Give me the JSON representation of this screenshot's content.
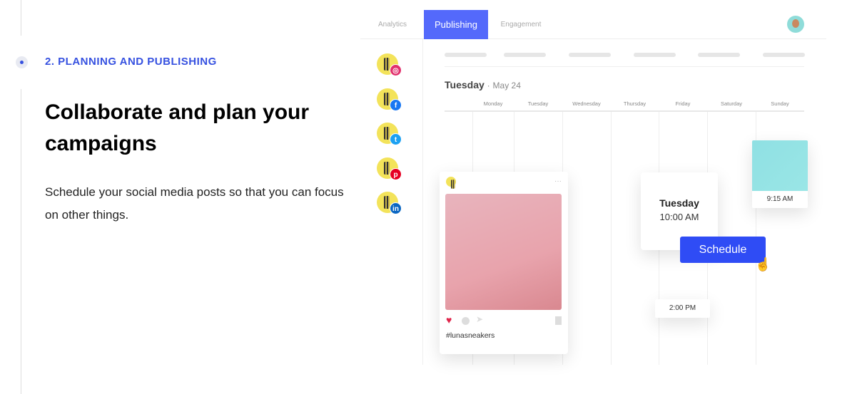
{
  "section": {
    "eyebrow": "2. PLANNING AND PUBLISHING",
    "title": "Collaborate and plan your campaigns",
    "body": "Schedule your social media posts so that you can focus on other things."
  },
  "app": {
    "tabs": [
      {
        "label": "Analytics"
      },
      {
        "label": "Publishing",
        "active": true
      },
      {
        "label": "Engagement"
      }
    ],
    "accounts": [
      {
        "network": "instagram",
        "icon": "instagram-icon",
        "color": "#e1306c",
        "glyph": "◎"
      },
      {
        "network": "facebook",
        "icon": "facebook-icon",
        "color": "#1877f2",
        "glyph": "f"
      },
      {
        "network": "twitter",
        "icon": "twitter-icon",
        "color": "#1da1f2",
        "glyph": "t"
      },
      {
        "network": "pinterest",
        "icon": "pinterest-icon",
        "color": "#e60023",
        "glyph": "p"
      },
      {
        "network": "linkedin",
        "icon": "linkedin-icon",
        "color": "#0a66c2",
        "glyph": "in"
      }
    ],
    "date": {
      "day": "Tuesday",
      "separator": "·",
      "date": "May 24"
    },
    "weekdays": [
      "Monday",
      "Tuesday",
      "Wednesday",
      "Thursday",
      "Friday",
      "Saturday",
      "Sunday"
    ],
    "post": {
      "hashtag": "#lunasneakers",
      "more": "···"
    },
    "scheduler": {
      "day": "Tuesday",
      "time": "10:00 AM",
      "button": "Schedule"
    },
    "slots": {
      "sneaker_time": "9:15 AM",
      "afternoon": "2:00 PM"
    },
    "accent": "#5469fb"
  }
}
